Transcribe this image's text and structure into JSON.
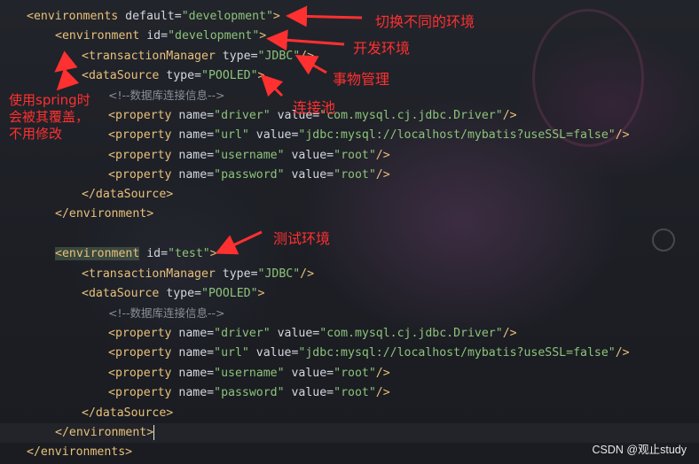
{
  "code": {
    "lines": [
      {
        "parts": [
          {
            "t": "<environments ",
            "c": "tag"
          },
          {
            "t": "default",
            "c": "attr"
          },
          {
            "t": "=",
            "c": "punct"
          },
          {
            "t": "\"development\"",
            "c": "val"
          },
          {
            "t": ">",
            "c": "tag"
          }
        ]
      },
      {
        "parts": [
          {
            "t": "<environment ",
            "c": "tag"
          },
          {
            "t": "id",
            "c": "attr"
          },
          {
            "t": "=",
            "c": "punct"
          },
          {
            "t": "\"development\"",
            "c": "val"
          },
          {
            "t": ">",
            "c": "tag"
          }
        ]
      },
      {
        "parts": [
          {
            "t": "<transactionManager ",
            "c": "tag"
          },
          {
            "t": "type",
            "c": "attr"
          },
          {
            "t": "=",
            "c": "punct"
          },
          {
            "t": "\"JDBC\"",
            "c": "val"
          },
          {
            "t": "/>",
            "c": "tag"
          }
        ]
      },
      {
        "parts": [
          {
            "t": "<dataSource ",
            "c": "tag"
          },
          {
            "t": "type",
            "c": "attr"
          },
          {
            "t": "=",
            "c": "punct"
          },
          {
            "t": "\"POOLED\"",
            "c": "val"
          },
          {
            "t": ">",
            "c": "tag"
          }
        ]
      },
      {
        "parts": [
          {
            "t": "<!--数据库连接信息-->",
            "c": "cmt"
          }
        ]
      },
      {
        "parts": [
          {
            "t": "<property ",
            "c": "tag"
          },
          {
            "t": "name",
            "c": "attr"
          },
          {
            "t": "=",
            "c": "punct"
          },
          {
            "t": "\"driver\"",
            "c": "val"
          },
          {
            "t": " value",
            "c": "attr"
          },
          {
            "t": "=",
            "c": "punct"
          },
          {
            "t": "\"com.mysql.cj.jdbc.Driver\"",
            "c": "val"
          },
          {
            "t": "/>",
            "c": "tag"
          }
        ]
      },
      {
        "parts": [
          {
            "t": "<property ",
            "c": "tag"
          },
          {
            "t": "name",
            "c": "attr"
          },
          {
            "t": "=",
            "c": "punct"
          },
          {
            "t": "\"url\"",
            "c": "val"
          },
          {
            "t": " value",
            "c": "attr"
          },
          {
            "t": "=",
            "c": "punct"
          },
          {
            "t": "\"jdbc:mysql://localhost/mybatis?useSSL=false\"",
            "c": "val"
          },
          {
            "t": "/>",
            "c": "tag"
          }
        ]
      },
      {
        "parts": [
          {
            "t": "<property ",
            "c": "tag"
          },
          {
            "t": "name",
            "c": "attr"
          },
          {
            "t": "=",
            "c": "punct"
          },
          {
            "t": "\"username\"",
            "c": "val"
          },
          {
            "t": " value",
            "c": "attr"
          },
          {
            "t": "=",
            "c": "punct"
          },
          {
            "t": "\"root\"",
            "c": "val"
          },
          {
            "t": "/>",
            "c": "tag"
          }
        ]
      },
      {
        "parts": [
          {
            "t": "<property ",
            "c": "tag"
          },
          {
            "t": "name",
            "c": "attr"
          },
          {
            "t": "=",
            "c": "punct"
          },
          {
            "t": "\"password\"",
            "c": "val"
          },
          {
            "t": " value",
            "c": "attr"
          },
          {
            "t": "=",
            "c": "punct"
          },
          {
            "t": "\"root\"",
            "c": "val"
          },
          {
            "t": "/>",
            "c": "tag"
          }
        ]
      },
      {
        "parts": [
          {
            "t": "</dataSource>",
            "c": "tag"
          }
        ]
      },
      {
        "parts": [
          {
            "t": "</environment>",
            "c": "tag"
          }
        ]
      },
      {
        "parts": []
      },
      {
        "parts": [
          {
            "t": "<environment",
            "c": "tag hl-tag"
          },
          {
            "t": " ",
            "c": "tag"
          },
          {
            "t": "id",
            "c": "attr"
          },
          {
            "t": "=",
            "c": "punct"
          },
          {
            "t": "\"test\"",
            "c": "val"
          },
          {
            "t": ">",
            "c": "tag"
          }
        ]
      },
      {
        "parts": [
          {
            "t": "<transactionManager ",
            "c": "tag"
          },
          {
            "t": "type",
            "c": "attr"
          },
          {
            "t": "=",
            "c": "punct"
          },
          {
            "t": "\"JDBC\"",
            "c": "val"
          },
          {
            "t": "/>",
            "c": "tag"
          }
        ]
      },
      {
        "parts": [
          {
            "t": "<dataSource ",
            "c": "tag"
          },
          {
            "t": "type",
            "c": "attr"
          },
          {
            "t": "=",
            "c": "punct"
          },
          {
            "t": "\"POOLED\"",
            "c": "val"
          },
          {
            "t": ">",
            "c": "tag"
          }
        ]
      },
      {
        "parts": [
          {
            "t": "<!--数据库连接信息-->",
            "c": "cmt"
          }
        ]
      },
      {
        "parts": [
          {
            "t": "<property ",
            "c": "tag"
          },
          {
            "t": "name",
            "c": "attr"
          },
          {
            "t": "=",
            "c": "punct"
          },
          {
            "t": "\"driver\"",
            "c": "val"
          },
          {
            "t": " value",
            "c": "attr"
          },
          {
            "t": "=",
            "c": "punct"
          },
          {
            "t": "\"com.mysql.cj.jdbc.Driver\"",
            "c": "val"
          },
          {
            "t": "/>",
            "c": "tag"
          }
        ]
      },
      {
        "parts": [
          {
            "t": "<property ",
            "c": "tag"
          },
          {
            "t": "name",
            "c": "attr"
          },
          {
            "t": "=",
            "c": "punct"
          },
          {
            "t": "\"url\"",
            "c": "val"
          },
          {
            "t": " value",
            "c": "attr"
          },
          {
            "t": "=",
            "c": "punct"
          },
          {
            "t": "\"jdbc:mysql://localhost/mybatis?useSSL=false\"",
            "c": "val"
          },
          {
            "t": "/>",
            "c": "tag"
          }
        ]
      },
      {
        "parts": [
          {
            "t": "<property ",
            "c": "tag"
          },
          {
            "t": "name",
            "c": "attr"
          },
          {
            "t": "=",
            "c": "punct"
          },
          {
            "t": "\"username\"",
            "c": "val"
          },
          {
            "t": " value",
            "c": "attr"
          },
          {
            "t": "=",
            "c": "punct"
          },
          {
            "t": "\"root\"",
            "c": "val"
          },
          {
            "t": "/>",
            "c": "tag"
          }
        ]
      },
      {
        "parts": [
          {
            "t": "<property ",
            "c": "tag"
          },
          {
            "t": "name",
            "c": "attr"
          },
          {
            "t": "=",
            "c": "punct"
          },
          {
            "t": "\"password\"",
            "c": "val"
          },
          {
            "t": " value",
            "c": "attr"
          },
          {
            "t": "=",
            "c": "punct"
          },
          {
            "t": "\"root\"",
            "c": "val"
          },
          {
            "t": "/>",
            "c": "tag"
          }
        ]
      },
      {
        "parts": [
          {
            "t": "</dataSource>",
            "c": "tag"
          }
        ]
      },
      {
        "parts": [
          {
            "t": "</environment>",
            "c": "tag"
          }
        ]
      },
      {
        "parts": [
          {
            "t": "</environments>",
            "c": "tag"
          }
        ]
      }
    ]
  },
  "annotations": {
    "switch_env": "切换不同的环境",
    "dev_env": "开发环境",
    "tx_mgmt": "事物管理",
    "conn_pool": "连接池",
    "spring_note": "使用spring时\n会被其覆盖，\n不用修改",
    "test_env": "测试环境"
  },
  "watermark": "CSDN @观止study",
  "colors": {
    "tag": "#e8c07a",
    "value": "#8cc37a",
    "comment": "#8a8f98",
    "annotation": "#ff3030"
  }
}
